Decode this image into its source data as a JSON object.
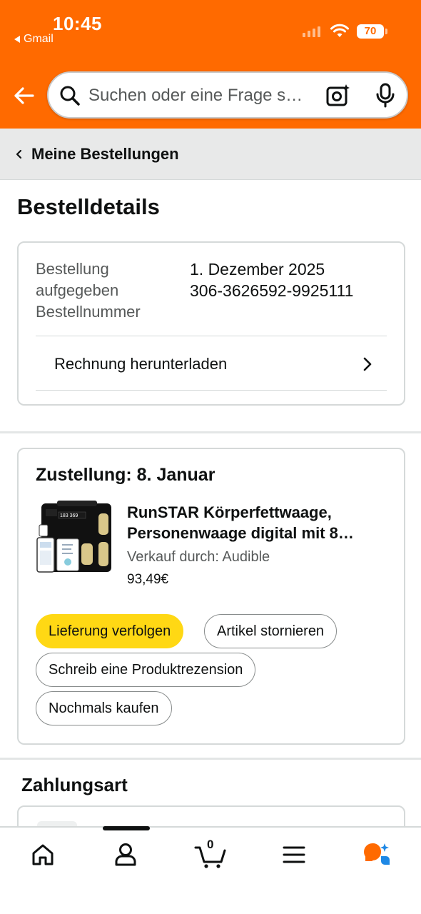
{
  "status_bar": {
    "time": "10:45",
    "back_app": "Gmail",
    "battery": "70"
  },
  "header": {
    "search_placeholder": "Suchen oder eine Frage stellen",
    "search_display": "Suchen oder eine Frage s…"
  },
  "breadcrumb": {
    "label": "Meine Bestellungen"
  },
  "page": {
    "title": "Bestelldetails"
  },
  "order_info": {
    "placed_label_1": "Bestellung",
    "placed_label_2": "aufgegeben",
    "number_label": "Bestellnummer",
    "placed_value": "1. Dezember 2025",
    "number_value": "306-3626592-9925111",
    "invoice_link": "Rechnung herunterladen"
  },
  "shipment": {
    "delivery": "Zustellung: 8. Januar",
    "product_title_line1": "RunSTAR Körperfettwaage,",
    "product_title_line2": "Personenwaage digital mit 8…",
    "seller": "Verkauf durch: Audible",
    "price": "93,49€",
    "actions": {
      "track": "Lieferung verfolgen",
      "cancel": "Artikel stornieren",
      "review": "Schreib eine Produktrezension",
      "buy_again": "Nochmals kaufen"
    }
  },
  "payment": {
    "title": "Zahlungsart"
  },
  "bottom_nav": {
    "cart_count": "0"
  },
  "colors": {
    "header_orange": "#ff6a00",
    "primary_button": "#ffd814",
    "assistant_orange": "#ff6a00",
    "assistant_blue": "#1e88e5"
  },
  "icons": [
    "back-arrow-icon",
    "search-icon",
    "camera-lens-icon",
    "microphone-icon",
    "chevron-left-icon",
    "chevron-right-icon",
    "home-icon",
    "account-icon",
    "cart-icon",
    "menu-icon",
    "assistant-icon"
  ]
}
